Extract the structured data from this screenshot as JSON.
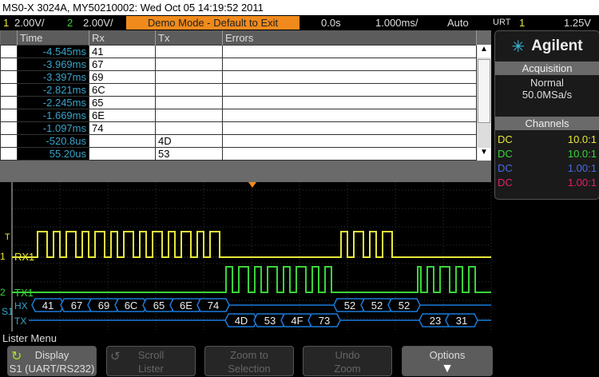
{
  "title": "MS0-X 3024A, MY50210002: Wed Oct 05 14:19:52 2011",
  "status": {
    "ch1_num": "1",
    "ch1_scale": "2.00V/",
    "ch2_num": "2",
    "ch2_scale": "2.00V/",
    "demo": "Demo Mode - Default to Exit",
    "delay": "0.0s",
    "timebase": "1.000ms/",
    "trigger_mode": "Auto",
    "trigger_type": "URT",
    "trigger_ch": "1",
    "trigger_level": "1.25V"
  },
  "lister": {
    "headers": [
      "Time",
      "Rx",
      "Tx",
      "Errors"
    ],
    "rows": [
      {
        "time": "-4.545ms",
        "rx": "41",
        "tx": ""
      },
      {
        "time": "-3.969ms",
        "rx": "67",
        "tx": ""
      },
      {
        "time": "-3.397ms",
        "rx": "69",
        "tx": ""
      },
      {
        "time": "-2.821ms",
        "rx": "6C",
        "tx": ""
      },
      {
        "time": "-2.245ms",
        "rx": "65",
        "tx": ""
      },
      {
        "time": "-1.669ms",
        "rx": "6E",
        "tx": ""
      },
      {
        "time": "-1.097ms",
        "rx": "74",
        "tx": ""
      },
      {
        "time": "-520.8us",
        "rx": "",
        "tx": "4D"
      },
      {
        "time": "55.20us",
        "rx": "",
        "tx": "53"
      }
    ]
  },
  "side": {
    "brand": "Agilent",
    "acq_title": "Acquisition",
    "acq_mode": "Normal",
    "acq_rate": "50.0MSa/s",
    "ch_title": "Channels",
    "channels": [
      {
        "coupling": "DC",
        "probe": "10.0:1",
        "color": "#e8e83a"
      },
      {
        "coupling": "DC",
        "probe": "10.0:1",
        "color": "#3ad43a"
      },
      {
        "coupling": "DC",
        "probe": "1.00:1",
        "color": "#4a6ae8"
      },
      {
        "coupling": "DC",
        "probe": "1.00:1",
        "color": "#e0206a"
      }
    ]
  },
  "wave": {
    "rx1_label": "RX1",
    "tx1_label": "TX1",
    "hx_label": "HX",
    "tx_label": "TX",
    "ch1_marker": "1",
    "ch2_marker": "2",
    "trig_marker": "T",
    "serial_marker": "S1",
    "rx_bytes": [
      "41",
      "67",
      "69",
      "6C",
      "65",
      "6E",
      "74",
      "52",
      "52",
      "52"
    ],
    "tx_bytes": [
      "4D",
      "53",
      "4F",
      "73",
      "23",
      "31"
    ]
  },
  "menu": {
    "title": "Lister Menu",
    "buttons": [
      {
        "line1": "Display",
        "line2": "S1 (UART/RS232)"
      },
      {
        "line1": "Scroll",
        "line2": "Lister"
      },
      {
        "line1": "Zoom to",
        "line2": "Selection"
      },
      {
        "line1": "Undo",
        "line2": "Zoom"
      },
      {
        "line1": "Options",
        "line2": ""
      }
    ]
  }
}
